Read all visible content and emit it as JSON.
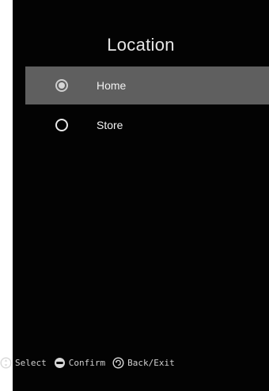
{
  "title": "Location",
  "options": [
    {
      "label": "Home",
      "selected": true
    },
    {
      "label": "Store",
      "selected": false
    }
  ],
  "hints": {
    "select": {
      "label": "Select",
      "icon": "dpad-icon"
    },
    "confirm": {
      "label": "Confirm",
      "icon": "enter-button-icon"
    },
    "back": {
      "label": "Back/Exit",
      "icon": "back-arrow-icon"
    }
  },
  "colors": {
    "background": "#030303",
    "selected_row": "#5f5f5f",
    "text": "#f2f2f2"
  }
}
